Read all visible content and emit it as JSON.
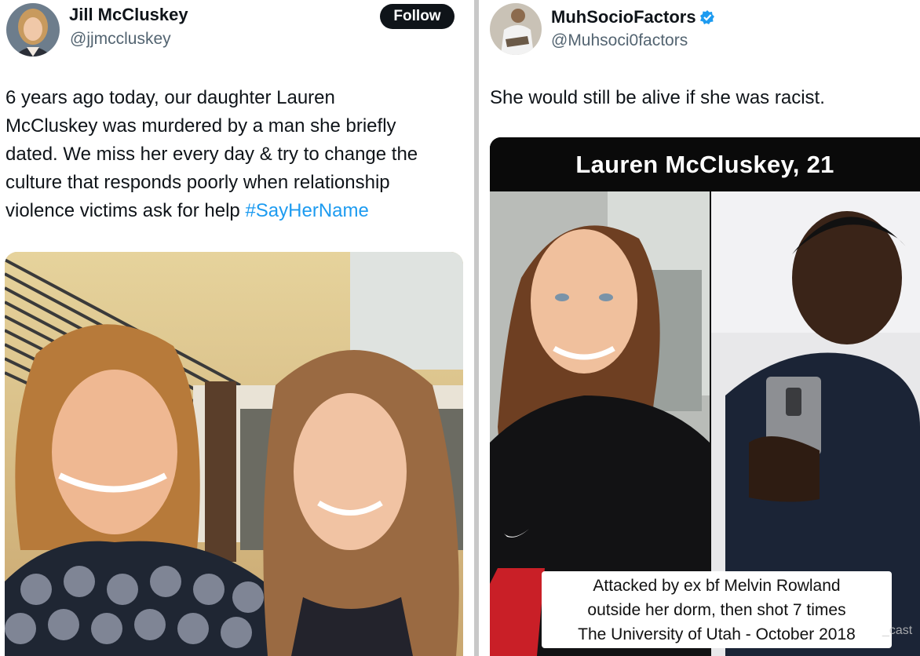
{
  "left_tweet": {
    "author": {
      "name": "Jill McCluskey",
      "handle": "@jjmccluskey"
    },
    "follow_label": "Follow",
    "text_lines": [
      "6 years ago today, our daughter Lauren",
      "McCluskey was murdered by a man she briefly",
      "dated. We miss her every day & try to change the",
      "culture that responds poorly when relationship",
      "violence victims ask for help "
    ],
    "hashtag": "#SayHerName",
    "hashtag_color": "#1d9bf0"
  },
  "right_tweet": {
    "author": {
      "name": "MuhSocioFactors",
      "handle": "@Muhsoci0factors",
      "verified_icon": "verified-badge-icon"
    },
    "text": "She would still be alive if she was racist.",
    "card": {
      "title": "Lauren McCluskey, 21",
      "caption_lines": [
        "Attacked by ex bf Melvin Rowland",
        "outside her dorm, then shot 7 times",
        "The University of Utah - October 2018"
      ],
      "watermark": "_cast"
    }
  },
  "colors": {
    "text": "#0f1419",
    "secondary_text": "#536471",
    "link": "#1d9bf0",
    "follow_button_bg": "#0f1419",
    "verified": "#1d9bf0"
  }
}
